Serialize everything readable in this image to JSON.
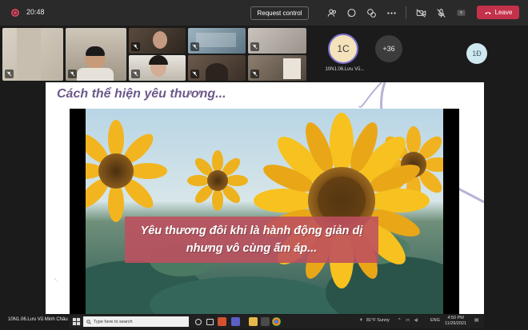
{
  "topbar": {
    "time": "20:48",
    "request_control_label": "Request control",
    "leave_label": "Leave"
  },
  "participants": {
    "avatar_1c_initials": "1C",
    "avatar_1c_name": "10N1.06.Lưu Vũ...",
    "more_count": "+36",
    "avatar_1d_initials": "1Đ"
  },
  "slide": {
    "title": "Cách thể hiện yêu thương...",
    "caption_line1": "Yêu thương đôi khi là hành động giản dị",
    "caption_line2": "nhưng vô cùng ấm áp..."
  },
  "presenter": {
    "name": "10N1.06.Lưu Vũ Minh Châu"
  },
  "taskbar": {
    "search_placeholder": "Type here to search",
    "weather": "81°F  Sunny",
    "language": "ENG",
    "clock_time": "4:50 PM",
    "clock_date": "11/29/2021"
  },
  "colors": {
    "leave": "#c4314b",
    "title": "#6c5a8a",
    "caption_bg": "#be505f",
    "avatar_ring": "#7a6fd0"
  }
}
